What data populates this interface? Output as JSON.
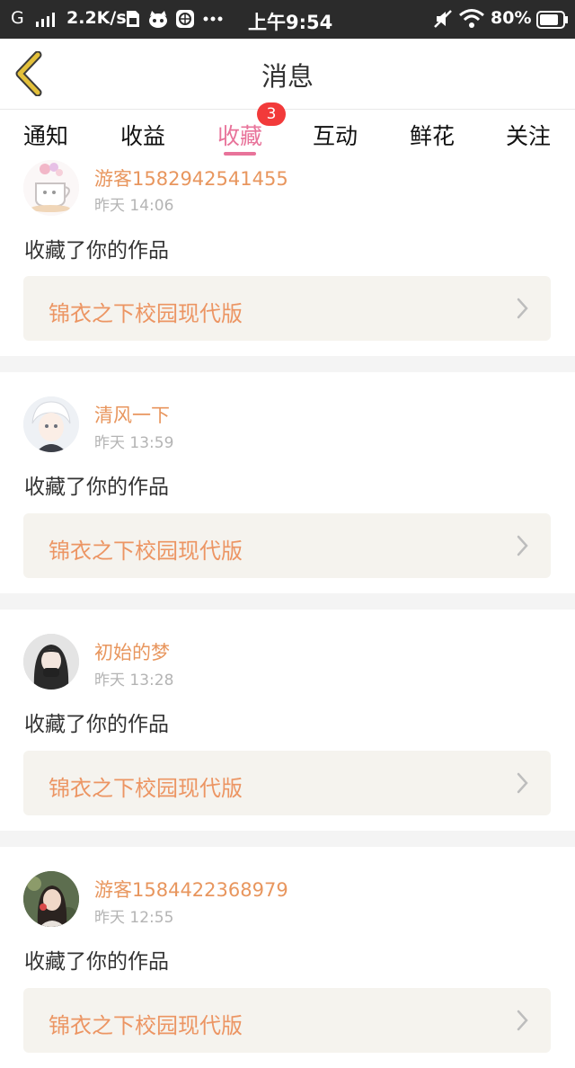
{
  "status_bar": {
    "carrier": "G",
    "speed": "2.2K/s",
    "time": "上午9:54",
    "battery": "80%",
    "icons": [
      "signal-icon",
      "sim-icon",
      "cat-icon",
      "browser-icon",
      "more-dots-icon",
      "mute-icon",
      "wifi-icon",
      "battery-icon"
    ]
  },
  "header": {
    "title": "消息",
    "back_icon": "chevron-left-icon"
  },
  "tabs": [
    {
      "label": "通知"
    },
    {
      "label": "收益"
    },
    {
      "label": "收藏",
      "active": true,
      "badge": "3"
    },
    {
      "label": "互动"
    },
    {
      "label": "鲜花"
    },
    {
      "label": "关注"
    }
  ],
  "items": [
    {
      "user": "游客1582942541455",
      "time": "昨天 14:06",
      "action": "收藏了你的作品",
      "work": "锦衣之下校园现代版"
    },
    {
      "user": "清风一下",
      "time": "昨天 13:59",
      "action": "收藏了你的作品",
      "work": "锦衣之下校园现代版"
    },
    {
      "user": "初始的梦",
      "time": "昨天 13:28",
      "action": "收藏了你的作品",
      "work": "锦衣之下校园现代版"
    },
    {
      "user": "游客1584422368979",
      "time": "昨天 12:55",
      "action": "收藏了你的作品",
      "work": "锦衣之下校园现代版"
    }
  ],
  "colors": {
    "accent": "#e8739a",
    "username": "#e8965e",
    "work_title": "#ec9563",
    "badge": "#f23a3a",
    "status_bar": "#2b2b2b",
    "back_arrow": "#e3c03a"
  }
}
